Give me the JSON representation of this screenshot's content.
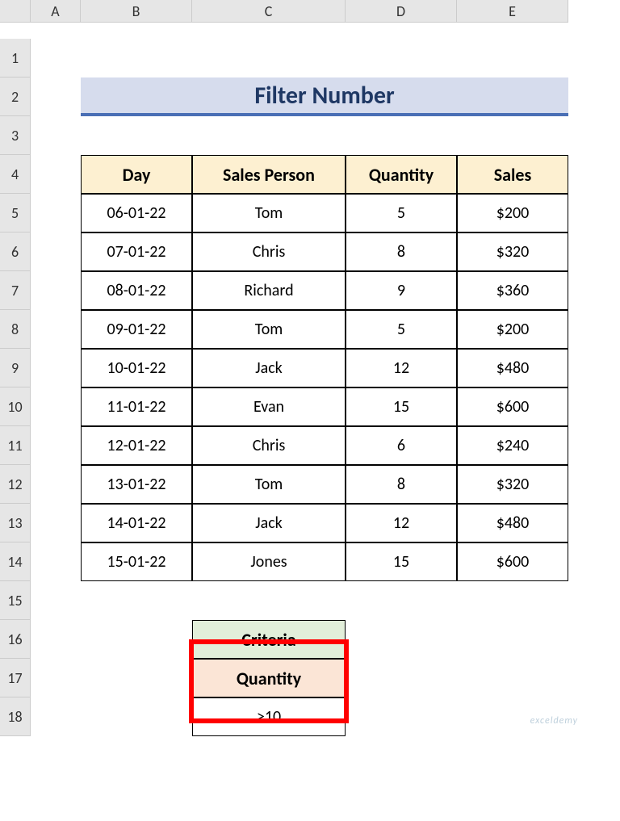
{
  "columns": [
    "A",
    "B",
    "C",
    "D",
    "E"
  ],
  "rows": [
    "1",
    "2",
    "3",
    "4",
    "5",
    "6",
    "7",
    "8",
    "9",
    "10",
    "11",
    "12",
    "13",
    "14",
    "15",
    "16",
    "17",
    "18"
  ],
  "title": "Filter Number",
  "table": {
    "headers": [
      "Day",
      "Sales Person",
      "Quantity",
      "Sales"
    ],
    "rows": [
      [
        "06-01-22",
        "Tom",
        "5",
        "$200"
      ],
      [
        "07-01-22",
        "Chris",
        "8",
        "$320"
      ],
      [
        "08-01-22",
        "Richard",
        "9",
        "$360"
      ],
      [
        "09-01-22",
        "Tom",
        "5",
        "$200"
      ],
      [
        "10-01-22",
        "Jack",
        "12",
        "$480"
      ],
      [
        "11-01-22",
        "Evan",
        "15",
        "$600"
      ],
      [
        "12-01-22",
        "Chris",
        "6",
        "$240"
      ],
      [
        "13-01-22",
        "Tom",
        "8",
        "$320"
      ],
      [
        "14-01-22",
        "Jack",
        "12",
        "$480"
      ],
      [
        "15-01-22",
        "Jones",
        "15",
        "$600"
      ]
    ]
  },
  "criteria": {
    "title": "Criteria",
    "field": "Quantity",
    "value": ">10"
  },
  "watermark": "exceldemy"
}
